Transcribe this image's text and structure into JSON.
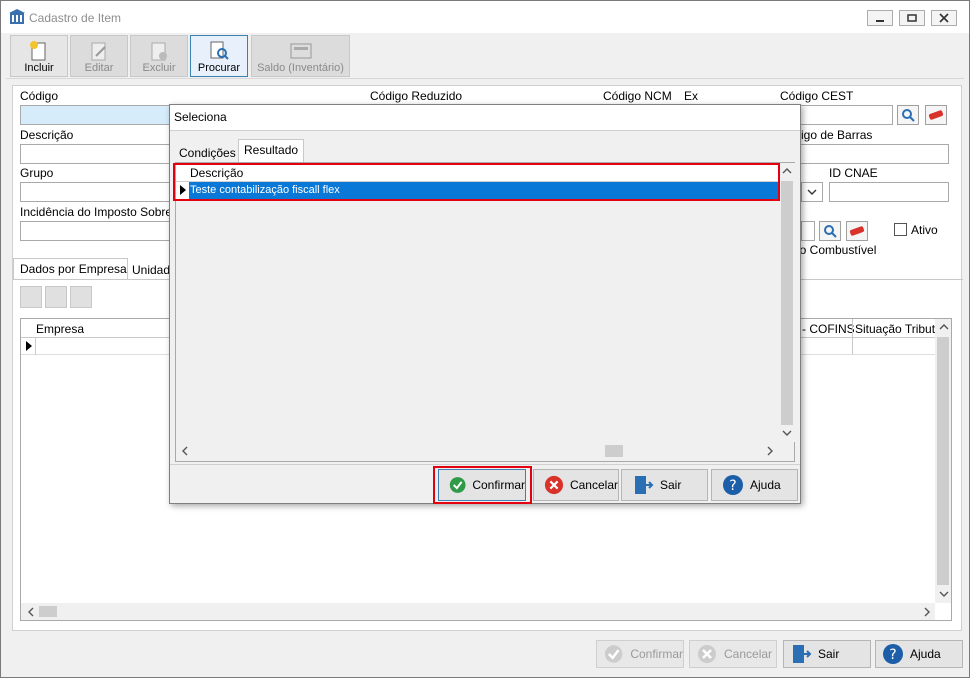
{
  "window": {
    "title": "Cadastro de Item"
  },
  "toolbar": {
    "buttons": [
      {
        "label": "Incluir",
        "state": "enabled"
      },
      {
        "label": "Editar",
        "state": "disabled"
      },
      {
        "label": "Excluir",
        "state": "disabled"
      },
      {
        "label": "Procurar",
        "state": "active"
      },
      {
        "label": "Saldo (Inventário)",
        "state": "disabled"
      }
    ]
  },
  "form": {
    "codigo_label": "Código",
    "codigo_reduzido_label": "Código Reduzido",
    "codigo_ncm_label": "Código NCM",
    "ex_label": "Ex",
    "codigo_cest_label": "Código CEST",
    "descricao_label": "Descrição",
    "codigo_barras_label": "igo de Barras",
    "grupo_label": "Grupo",
    "id_cnae_label": "ID CNAE",
    "incidencia_label": "Incidência do Imposto Sobre",
    "ativo_label": "Ativo",
    "combustivel_label": "ico Combustível"
  },
  "tabs": {
    "dados_por_empresa": "Dados por Empresa",
    "unidade": "Unidad"
  },
  "grid": {
    "columns": [
      "Empresa",
      "- COFINS",
      "Situação Tributa"
    ]
  },
  "bottom": {
    "confirmar": "Confirmar",
    "cancelar": "Cancelar",
    "sair": "Sair",
    "ajuda": "Ajuda"
  },
  "dialog": {
    "title": "Seleciona",
    "tabs": [
      "Condições",
      "Resultado"
    ],
    "selected_tab": "Resultado",
    "column_header": "Descrição",
    "rows": [
      "Teste contabilização fiscall flex"
    ],
    "buttons": {
      "confirmar": "Confirmar",
      "cancelar": "Cancelar",
      "sair": "Sair",
      "ajuda": "Ajuda"
    }
  },
  "colors": {
    "selection": "#0a78d7",
    "highlight": "#e3000f",
    "accent_blue": "#3c7fb1"
  }
}
